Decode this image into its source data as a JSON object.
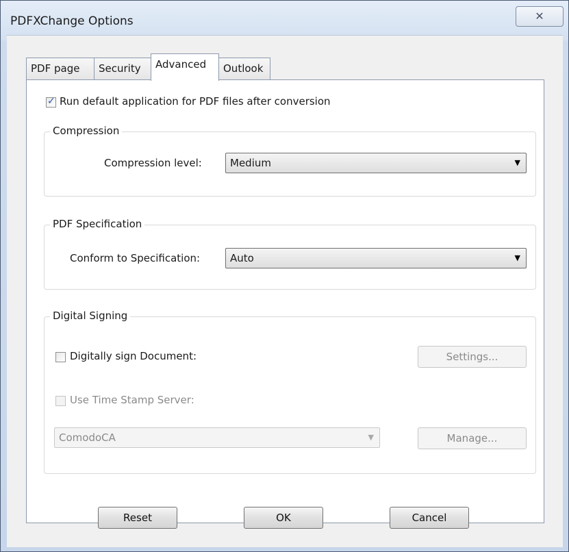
{
  "window": {
    "title": "PDFXChange Options",
    "close_label": "✕"
  },
  "tabs": [
    {
      "label": "PDF page"
    },
    {
      "label": "Security"
    },
    {
      "label": "Advanced"
    },
    {
      "label": "Outlook"
    }
  ],
  "active_tab": "Advanced",
  "advanced": {
    "run_default_app": {
      "label": "Run default application for PDF files after conversion",
      "checked": true
    },
    "compression": {
      "group_title": "Compression",
      "level_label": "Compression level:",
      "level_value": "Medium"
    },
    "pdf_spec": {
      "group_title": "PDF Specification",
      "conform_label": "Conform to Specification:",
      "conform_value": "Auto"
    },
    "digital_signing": {
      "group_title": "Digital Signing",
      "sign_label": "Digitally sign Document:",
      "sign_checked": false,
      "settings_button": "Settings...",
      "timestamp_label": "Use Time Stamp Server:",
      "timestamp_checked": false,
      "server_value": "ComodoCA",
      "manage_button": "Manage..."
    }
  },
  "footer": {
    "reset": "Reset",
    "ok": "OK",
    "cancel": "Cancel"
  },
  "icons": {
    "close": "close-icon",
    "dropdown": "chevron-down-icon",
    "check": "checkmark-icon"
  }
}
